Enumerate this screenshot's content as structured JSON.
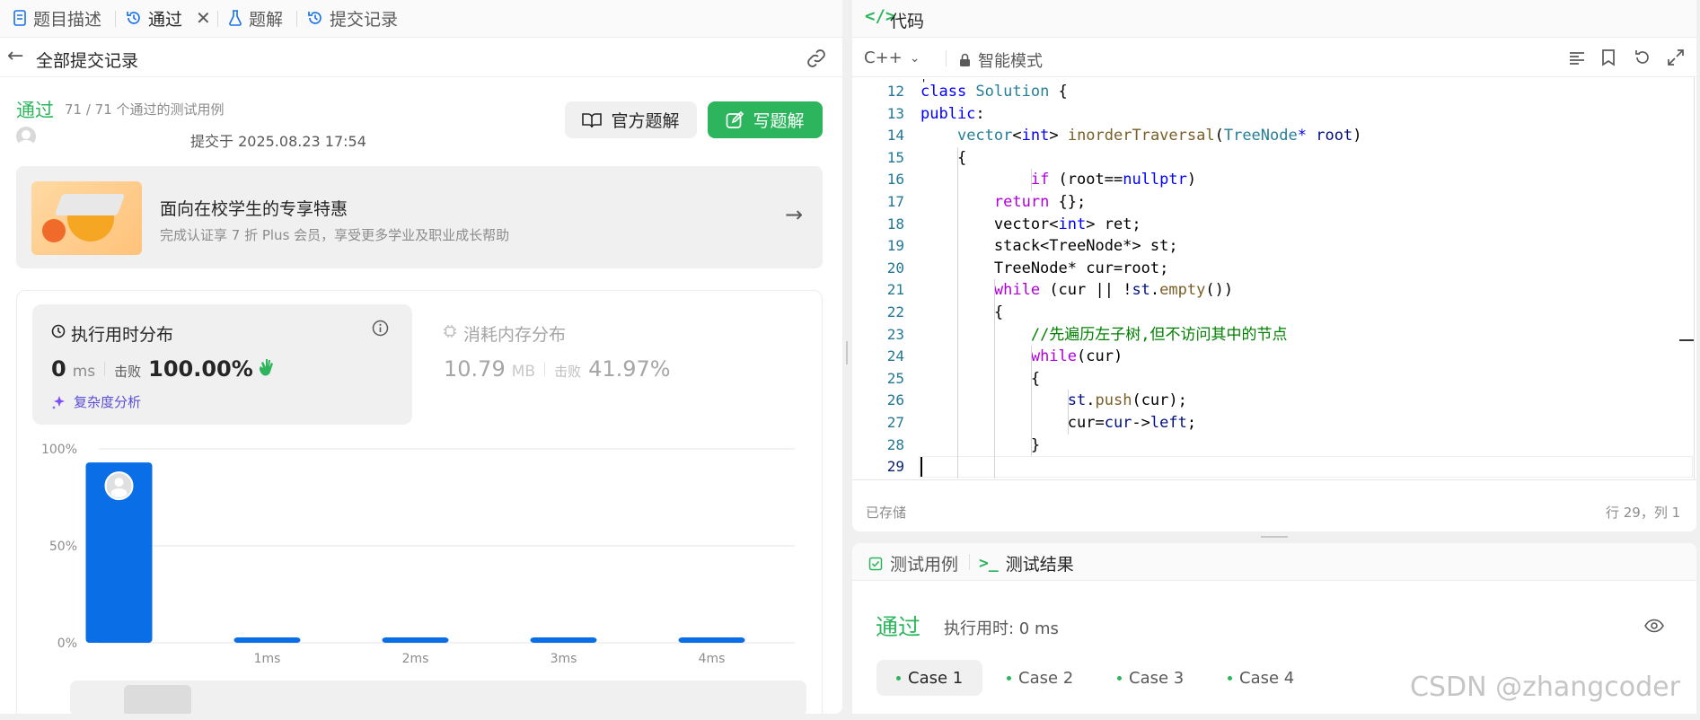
{
  "left_tabs": [
    {
      "label": "题目描述",
      "icon": "document-icon"
    },
    {
      "label": "通过",
      "icon": "history-icon"
    },
    {
      "label": "题解",
      "icon": "flask-icon"
    },
    {
      "label": "提交记录",
      "icon": "history-icon"
    }
  ],
  "back_label": "全部提交记录",
  "result": {
    "status": "通过",
    "cases_text": "71 / 71 个通过的测试用例",
    "submitted": "提交于 2025.08.23 17:54",
    "official_btn": "官方题解",
    "write_btn": "写题解"
  },
  "promo": {
    "title": "面向在校学生的专享特惠",
    "subtitle": "完成认证享 7 折 Plus 会员，享受更多学业及职业成长帮助"
  },
  "runtime": {
    "title": "执行用时分布",
    "value": "0",
    "unit": "ms",
    "beats_label": "击败",
    "beats": "100.00%",
    "analysis": "复杂度分析"
  },
  "memory": {
    "title": "消耗内存分布",
    "value": "10.79",
    "unit": "MB",
    "beats_label": "击败",
    "beats": "41.97%"
  },
  "chart_data": {
    "type": "bar",
    "categories": [
      "",
      "1ms",
      "2ms",
      "3ms",
      "4ms"
    ],
    "values": [
      93,
      1,
      1,
      1,
      1
    ],
    "ylim": [
      0,
      100
    ],
    "yticks": [
      "0%",
      "50%",
      "100%"
    ],
    "highlight_index": 0,
    "bar_color": "#0a6ee6",
    "grid": true
  },
  "editor": {
    "title": "代码",
    "language": "C++",
    "mode": "智能模式",
    "saved": "已存储",
    "cursor": "行 29，列 1",
    "lines": [
      {
        "n": "12",
        "tokens": [
          [
            "kw",
            "class "
          ],
          [
            "ty",
            "Solution"
          ],
          [
            "tx",
            " {"
          ]
        ]
      },
      {
        "n": "13",
        "tokens": [
          [
            "kw",
            "public"
          ],
          [
            "tx",
            ":"
          ]
        ]
      },
      {
        "n": "14",
        "tokens": [
          [
            "tx",
            "    "
          ],
          [
            "ty",
            "vector"
          ],
          [
            "tx",
            "<"
          ],
          [
            "kw",
            "int"
          ],
          [
            "tx",
            "> "
          ],
          [
            "fn",
            "inorderTraversal"
          ],
          [
            "tx",
            "("
          ],
          [
            "ty",
            "TreeNode"
          ],
          [
            "kw",
            "*"
          ],
          [
            "tx",
            " "
          ],
          [
            "pl",
            "root"
          ],
          [
            "tx",
            ")"
          ]
        ]
      },
      {
        "n": "15",
        "tokens": [
          [
            "tx",
            "    {"
          ]
        ]
      },
      {
        "n": "16",
        "tokens": [
          [
            "tx",
            "            "
          ],
          [
            "kw2",
            "if"
          ],
          [
            "tx",
            " (root=="
          ],
          [
            "kw",
            "nullptr"
          ],
          [
            "tx",
            ")"
          ]
        ]
      },
      {
        "n": "17",
        "tokens": [
          [
            "tx",
            "        "
          ],
          [
            "kw2",
            "return"
          ],
          [
            "tx",
            " {};"
          ]
        ]
      },
      {
        "n": "18",
        "tokens": [
          [
            "tx",
            "        vector<"
          ],
          [
            "kw",
            "int"
          ],
          [
            "tx",
            "> ret;"
          ]
        ]
      },
      {
        "n": "19",
        "tokens": [
          [
            "tx",
            "        stack<TreeNode*> st;"
          ]
        ]
      },
      {
        "n": "20",
        "tokens": [
          [
            "tx",
            "        TreeNode* cur=root;"
          ]
        ]
      },
      {
        "n": "21",
        "tokens": [
          [
            "tx",
            "        "
          ],
          [
            "kw2",
            "while"
          ],
          [
            "tx",
            " (cur || !"
          ],
          [
            "pl",
            "st"
          ],
          [
            "tx",
            "."
          ],
          [
            "fn",
            "empty"
          ],
          [
            "tx",
            "())"
          ]
        ]
      },
      {
        "n": "22",
        "tokens": [
          [
            "tx",
            "        {"
          ]
        ]
      },
      {
        "n": "23",
        "tokens": [
          [
            "tx",
            "            "
          ],
          [
            "cm",
            "//先遍历左子树,但不访问其中的节点"
          ]
        ]
      },
      {
        "n": "24",
        "tokens": [
          [
            "tx",
            "            "
          ],
          [
            "kw2",
            "while"
          ],
          [
            "tx",
            "(cur)"
          ]
        ]
      },
      {
        "n": "25",
        "tokens": [
          [
            "tx",
            "            {"
          ]
        ]
      },
      {
        "n": "26",
        "tokens": [
          [
            "tx",
            "                "
          ],
          [
            "pl",
            "st"
          ],
          [
            "tx",
            "."
          ],
          [
            "fn",
            "push"
          ],
          [
            "tx",
            "(cur);"
          ]
        ]
      },
      {
        "n": "27",
        "tokens": [
          [
            "tx",
            "                cur="
          ],
          [
            "pl",
            "cur"
          ],
          [
            "tx",
            "->"
          ],
          [
            "pl",
            "left"
          ],
          [
            "tx",
            ";"
          ]
        ]
      },
      {
        "n": "28",
        "tokens": [
          [
            "tx",
            "            }"
          ]
        ]
      },
      {
        "n": "29",
        "tokens": []
      }
    ]
  },
  "test": {
    "tab_cases": "测试用例",
    "tab_result": "测试结果",
    "status": "通过",
    "runtime": "执行用时: 0 ms",
    "cases": [
      "Case 1",
      "Case 2",
      "Case 3",
      "Case 4"
    ]
  },
  "watermark": "CSDN @zhangcoder"
}
